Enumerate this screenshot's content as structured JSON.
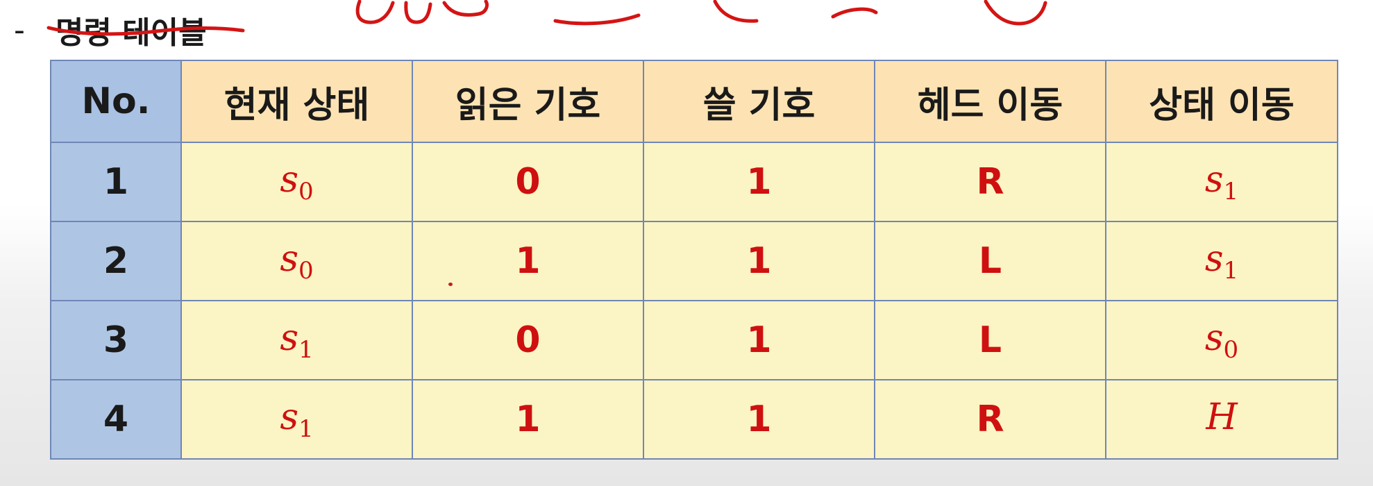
{
  "heading": {
    "dash": "-",
    "title": "명령 테이블"
  },
  "table": {
    "headers": [
      "No.",
      "현재 상태",
      "읽은 기호",
      "쓸 기호",
      "헤드 이동",
      "상태 이동"
    ],
    "rows": [
      {
        "no": "1",
        "current_state": {
          "sym": "s",
          "sub": "0"
        },
        "read": "0",
        "write": "1",
        "head": "R",
        "next_state": {
          "sym": "s",
          "sub": "1"
        }
      },
      {
        "no": "2",
        "current_state": {
          "sym": "s",
          "sub": "0"
        },
        "read": "1",
        "write": "1",
        "head": "L",
        "next_state": {
          "sym": "s",
          "sub": "1"
        }
      },
      {
        "no": "3",
        "current_state": {
          "sym": "s",
          "sub": "1"
        },
        "read": "0",
        "write": "1",
        "head": "L",
        "next_state": {
          "sym": "s",
          "sub": "0"
        }
      },
      {
        "no": "4",
        "current_state": {
          "sym": "s",
          "sub": "1"
        },
        "read": "1",
        "write": "1",
        "head": "R",
        "next_state": {
          "sym": "H",
          "sub": ""
        }
      }
    ]
  },
  "colors": {
    "header_bg": "#fde3b3",
    "no_column_bg": "#aec6e4",
    "cell_bg": "#fbf4c4",
    "value_text": "#cf1010",
    "border": "#6f86b6",
    "annotation_ink": "#d41414"
  }
}
